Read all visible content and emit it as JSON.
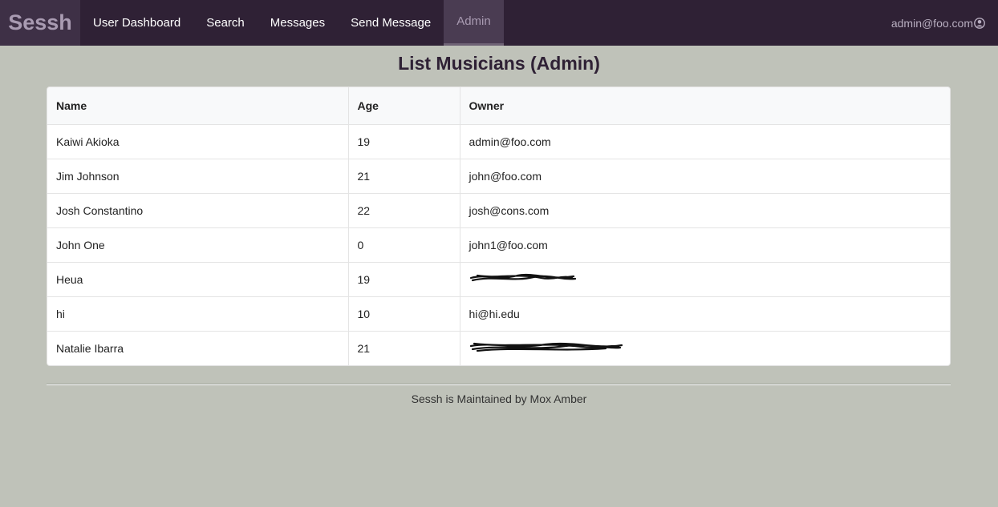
{
  "nav": {
    "brand": "Sessh",
    "items": [
      "User Dashboard",
      "Search",
      "Messages",
      "Send Message",
      "Admin"
    ],
    "active": "Admin",
    "user": "admin@foo.com"
  },
  "page": {
    "title": "List Musicians (Admin)"
  },
  "table": {
    "headers": [
      "Name",
      "Age",
      "Owner"
    ],
    "rows": [
      [
        "Kaiwi Akioka",
        "19",
        "admin@foo.com"
      ],
      [
        "Jim Johnson",
        "21",
        "john@foo.com"
      ],
      [
        "Josh Constantino",
        "22",
        "josh@cons.com"
      ],
      [
        "John One",
        "0",
        "john1@foo.com"
      ],
      [
        "Heua",
        "19",
        ""
      ],
      [
        "hi",
        "10",
        "hi@hi.edu"
      ],
      [
        "Natalie Ibarra",
        "21",
        ""
      ]
    ]
  },
  "footer": {
    "text": "Sessh is Maintained by Mox Amber"
  }
}
